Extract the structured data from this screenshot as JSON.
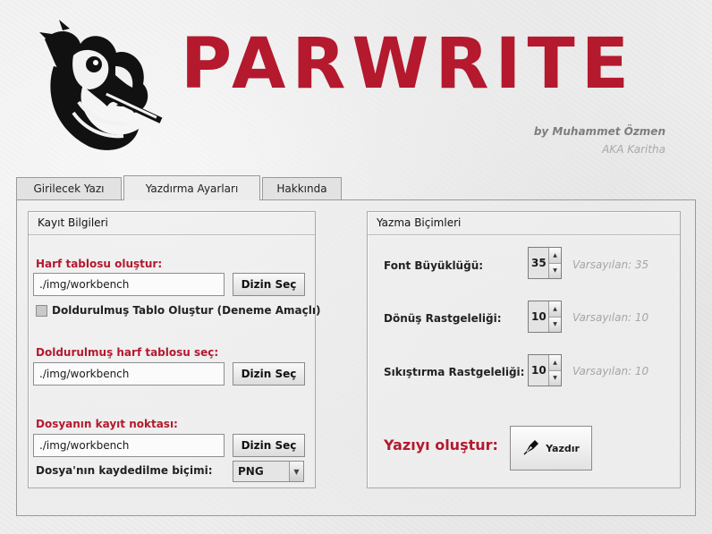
{
  "header": {
    "title": "PARWRITE",
    "author": "by Muhammet Özmen",
    "alias": "AKA Karitha",
    "logo_icon": "parrot-with-pen-icon"
  },
  "tabs": [
    {
      "label": "Girilecek Yazı",
      "active": false
    },
    {
      "label": "Yazdırma Ayarları",
      "active": true
    },
    {
      "label": "Hakkında",
      "active": false
    }
  ],
  "record_group": {
    "title": "Kayıt Bilgileri",
    "letter_table": {
      "label": "Harf tablosu oluştur:",
      "path": "./img/workbench",
      "button": "Dizin Seç"
    },
    "checkbox": {
      "label": "Doldurulmuş Tablo Oluştur (Deneme Amaçlı)",
      "checked": false
    },
    "filled_table": {
      "label": "Doldurulmuş harf tablosu seç:",
      "path": "./img/workbench",
      "button": "Dizin Seç"
    },
    "save_point": {
      "label": "Dosyanın kayıt noktası:",
      "path": "./img/workbench",
      "button": "Dizin Seç"
    },
    "save_format": {
      "label": "Dosya'nın kaydedilme biçimi:",
      "value": "PNG"
    }
  },
  "format_group": {
    "title": "Yazma Biçimleri",
    "font_size": {
      "label": "Font Büyüklüğü:",
      "value": "35",
      "hint": "Varsayılan: 35"
    },
    "rotation": {
      "label": "Dönüş Rastgeleliği:",
      "value": "10",
      "hint": "Varsayılan: 10"
    },
    "compression": {
      "label": "Sıkıştırma Rastgeleliği:",
      "value": "10",
      "hint": "Varsayılan: 10"
    },
    "create_label": "Yazıyı oluştur:",
    "print_button": "Yazdır",
    "print_icon": "fountain-pen-icon"
  },
  "colors": {
    "brand_red": "#b4192e",
    "hint_gray": "#a6a6a6"
  }
}
